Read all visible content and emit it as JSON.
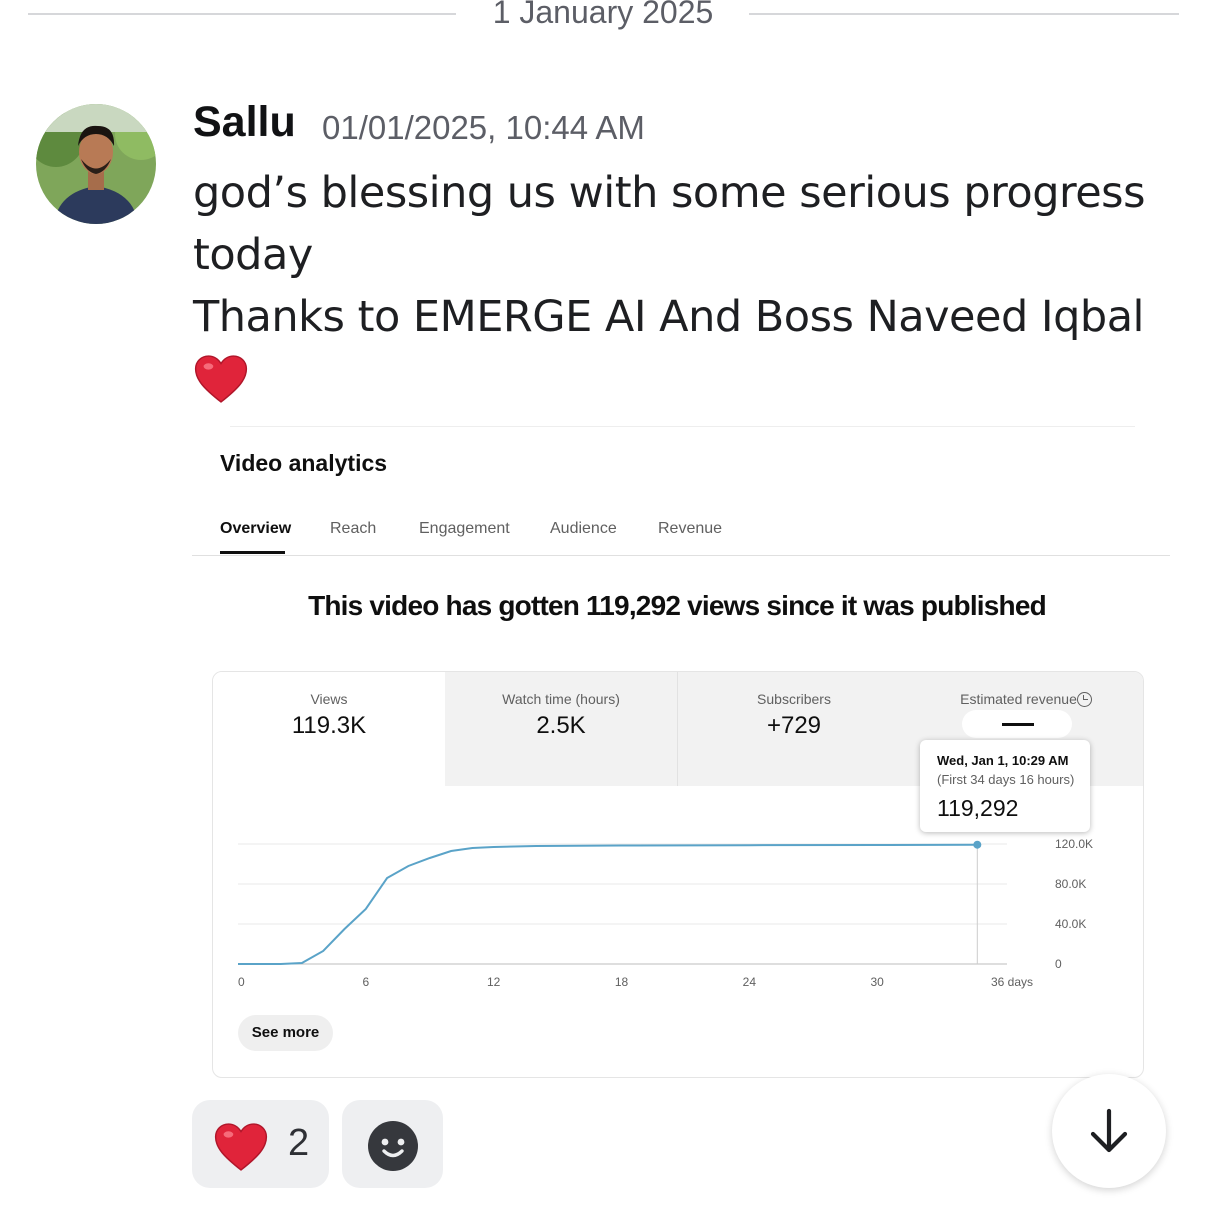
{
  "divider": {
    "date": "1 January 2025"
  },
  "message": {
    "author": "Sallu",
    "timestamp": "01/01/2025, 10:44 AM",
    "lines": [
      "god’s blessing us with some serious progress",
      "today",
      "Thanks to EMERGE AI And Boss Naveed Iqbal"
    ],
    "emoji": "heart-emoji"
  },
  "analytics": {
    "title": "Video analytics",
    "tabs": [
      "Overview",
      "Reach",
      "Engagement",
      "Audience",
      "Revenue"
    ],
    "active_tab": "Overview",
    "headline": "This video has gotten 119,292 views since it was published",
    "metrics": [
      {
        "name": "Views",
        "value": "119.3K"
      },
      {
        "name": "Watch time (hours)",
        "value": "2.5K"
      },
      {
        "name": "Subscribers",
        "value": "+729"
      },
      {
        "name": "Estimated revenue",
        "value": "—"
      }
    ],
    "tooltip": {
      "date": "Wed, Jan 1, 10:29 AM",
      "sub": "(First 34 days 16 hours)",
      "value": "119,292"
    },
    "see_more": "See more",
    "line_color": "#5aa3c8"
  },
  "chart_data": {
    "type": "line",
    "x_ticks": [
      "0",
      "6",
      "12",
      "18",
      "24",
      "30",
      "36 days"
    ],
    "y_ticks": [
      "0",
      "40.0K",
      "80.0K",
      "120.0K"
    ],
    "xlim": [
      0,
      36
    ],
    "ylim": [
      0,
      120000
    ],
    "x": [
      0,
      1,
      2,
      3,
      4,
      5,
      6,
      7,
      8,
      9,
      10,
      11,
      12,
      14,
      18,
      24,
      30,
      34.7
    ],
    "y": [
      0,
      0,
      0,
      1000,
      13000,
      35000,
      55000,
      86000,
      98000,
      106000,
      113000,
      116000,
      117000,
      118000,
      118500,
      118800,
      119000,
      119292
    ]
  },
  "reactions": [
    {
      "emoji": "heart-emoji",
      "count": "2"
    }
  ],
  "colors": {
    "accent": "#5aa3c8",
    "heart": "#e0243a"
  }
}
